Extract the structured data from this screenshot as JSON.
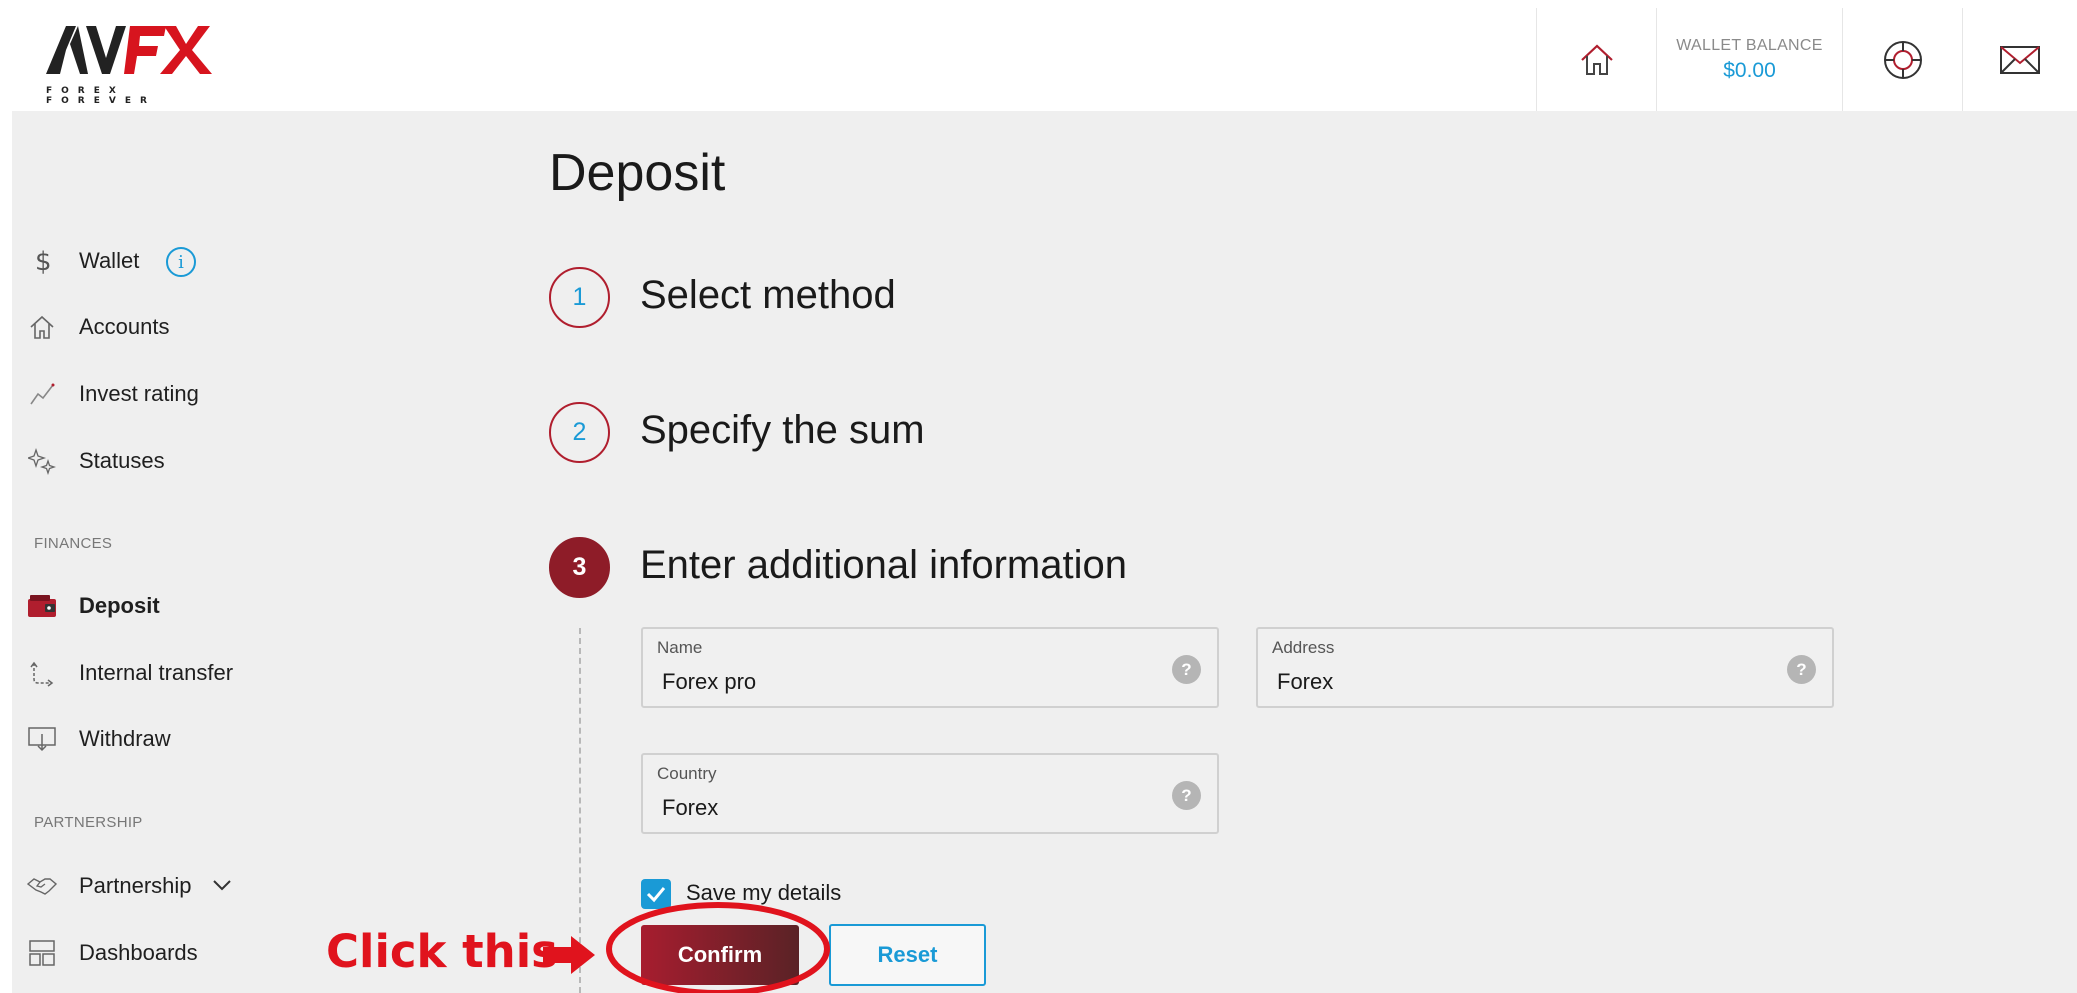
{
  "header": {
    "logo_tagline": "FOREX FOREVER",
    "wallet_balance_label": "WALLET BALANCE",
    "wallet_balance_value": "$0.00",
    "icons": [
      "home-icon",
      "support-lifebuoy-icon",
      "mail-icon"
    ]
  },
  "sidebar": {
    "items": [
      {
        "label": "Wallet",
        "icon": "dollar-icon"
      },
      {
        "label": "Accounts",
        "icon": "home-icon"
      },
      {
        "label": "Invest rating",
        "icon": "chart-line-icon"
      },
      {
        "label": "Statuses",
        "icon": "sparkles-icon"
      }
    ],
    "finances_label": "FINANCES",
    "finances_items": [
      {
        "label": "Deposit",
        "icon": "wallet-icon",
        "active": true
      },
      {
        "label": "Internal transfer",
        "icon": "transfer-icon"
      },
      {
        "label": "Withdraw",
        "icon": "withdraw-icon"
      }
    ],
    "partnership_label": "PARTNERSHIP",
    "partnership_items": [
      {
        "label": "Partnership",
        "icon": "handshake-icon"
      },
      {
        "label": "Dashboards",
        "icon": "dashboard-icon"
      }
    ],
    "wallet_info": "i"
  },
  "main": {
    "title": "Deposit",
    "steps": [
      {
        "number": "1",
        "title": "Select method"
      },
      {
        "number": "2",
        "title": "Specify the sum"
      },
      {
        "number": "3",
        "title": "Enter additional information",
        "active": true
      }
    ],
    "fields": {
      "name": {
        "label": "Name",
        "value": "Forex pro"
      },
      "address": {
        "label": "Address",
        "value": "Forex"
      },
      "country": {
        "label": "Country",
        "value": "Forex"
      },
      "help": "?"
    },
    "save_details_label": "Save my details",
    "save_details_checked": true,
    "confirm_label": "Confirm",
    "reset_label": "Reset"
  },
  "annotation": {
    "text": "Click this",
    "color": "#e0131d"
  },
  "colors": {
    "accent_blue": "#1a9ad6",
    "brand_red": "#a71d2f",
    "background": "#efefef"
  }
}
